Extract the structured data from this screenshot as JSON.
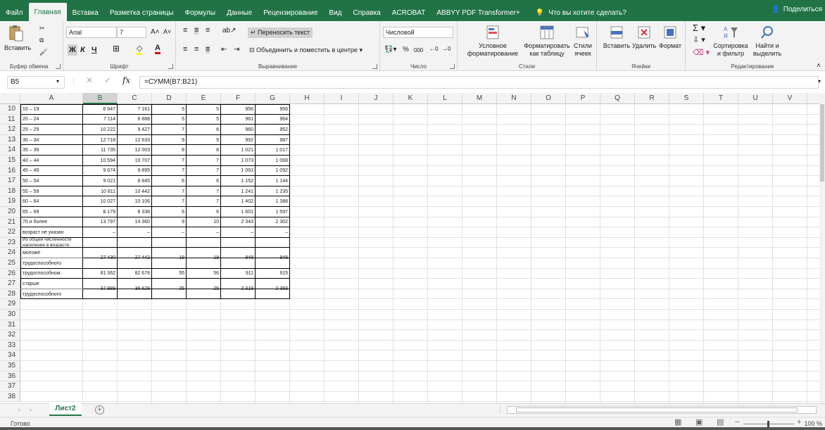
{
  "tabs": [
    "Файл",
    "Главная",
    "Вставка",
    "Разметка страницы",
    "Формулы",
    "Данные",
    "Рецензирование",
    "Вид",
    "Справка",
    "ACROBAT",
    "ABBYY PDF Transformer+"
  ],
  "active_tab": "Главная",
  "tell_me": "Что вы хотите сделать?",
  "share": "Поделиться",
  "ribbon": {
    "clipboard": {
      "paste": "Вставить",
      "label": "Буфер обмена"
    },
    "font": {
      "name": "Arial",
      "size": "7",
      "bold": "Ж",
      "italic": "К",
      "underline": "Ч",
      "label": "Шрифт"
    },
    "alignment": {
      "wrap": "Переносить текст",
      "merge": "Объединить и поместить в центре",
      "label": "Выравнивание"
    },
    "number": {
      "format": "Числовой",
      "percent": "%",
      "thousands": "000",
      "label": "Число"
    },
    "styles": {
      "conditional": "Условное форматирование",
      "as_table": "Форматировать как таблицу",
      "cell_styles": "Стили ячеек",
      "label": "Стили"
    },
    "cells": {
      "insert": "Вставить",
      "delete": "Удалить",
      "format": "Формат",
      "label": "Ячейки"
    },
    "editing": {
      "sort": "Сортировка и фильтр",
      "find": "Найти и выделить",
      "label": "Редактирование"
    }
  },
  "formula_bar": {
    "name_box": "B5",
    "formula": "=СУММ(B7:B21)"
  },
  "columns": [
    "A",
    "B",
    "C",
    "D",
    "E",
    "F",
    "G",
    "H",
    "I",
    "J",
    "K",
    "L",
    "M",
    "N",
    "O",
    "P",
    "Q",
    "R",
    "S",
    "T",
    "U",
    "V"
  ],
  "selected_column": "B",
  "rows": [
    {
      "n": "10",
      "a": "15 – 19",
      "b": "6 947",
      "c": "7 161",
      "d": "5",
      "e": "5",
      "f": "956",
      "g": "956"
    },
    {
      "n": "11",
      "a": "20 – 24",
      "b": "7 114",
      "c": "6 888",
      "d": "5",
      "e": "5",
      "f": "961",
      "g": "964"
    },
    {
      "n": "12",
      "a": "25 – 29",
      "b": "10 222",
      "c": "9 427",
      "d": "7",
      "e": "6",
      "f": "960",
      "g": "952"
    },
    {
      "n": "13",
      "a": "30 – 34",
      "b": "12 718",
      "c": "12 633",
      "d": "9",
      "e": "9",
      "f": "992",
      "g": "987"
    },
    {
      "n": "14",
      "a": "35 – 39",
      "b": "11 735",
      "c": "12 003",
      "d": "8",
      "e": "8",
      "f": "1 021",
      "g": "1 017"
    },
    {
      "n": "15",
      "a": "40 – 44",
      "b": "10 594",
      "c": "10 707",
      "d": "7",
      "e": "7",
      "f": "1 073",
      "g": "1 068"
    },
    {
      "n": "16",
      "a": "45 – 49",
      "b": "9 674",
      "c": "9 895",
      "d": "7",
      "e": "7",
      "f": "1 091",
      "g": "1 092"
    },
    {
      "n": "17",
      "a": "50 – 54",
      "b": "9 021",
      "c": "8 845",
      "d": "6",
      "e": "6",
      "f": "1 152",
      "g": "1 144"
    },
    {
      "n": "18",
      "a": "55 – 59",
      "b": "10 811",
      "c": "10 442",
      "d": "7",
      "e": "7",
      "f": "1 241",
      "g": "1 235"
    },
    {
      "n": "19",
      "a": "60 – 64",
      "b": "10 027",
      "c": "10 106",
      "d": "7",
      "e": "7",
      "f": "1 402",
      "g": "1 388"
    },
    {
      "n": "20",
      "a": "65 – 69",
      "b": "8 179",
      "c": "8 338",
      "d": "6",
      "e": "6",
      "f": "1 601",
      "g": "1 597"
    },
    {
      "n": "21",
      "a": "70 и более",
      "b": "13 797",
      "c": "14 360",
      "d": "9",
      "e": "10",
      "f": "2 343",
      "g": "2 302"
    },
    {
      "n": "22",
      "a": "возраст не указан",
      "b": "–",
      "c": "–",
      "d": "–",
      "e": "–",
      "f": "–",
      "g": "–"
    },
    {
      "n": "23",
      "a": "Из общей численности население в возрасте:",
      "b": "",
      "c": "",
      "d": "",
      "e": "",
      "f": "",
      "g": ""
    },
    {
      "n": "24",
      "a": "моложе",
      "b": "27 430",
      "c": "27 442",
      "d": "19",
      "e": "19",
      "f": "949",
      "g": "948"
    },
    {
      "n": "25",
      "a": "трудоспособного",
      "b": "",
      "c": "",
      "d": "",
      "e": "",
      "f": "",
      "g": ""
    },
    {
      "n": "26",
      "a": "трудоспособном.",
      "b": "81 362",
      "c": "82 678",
      "d": "55",
      "e": "56",
      "f": "911",
      "g": "915"
    },
    {
      "n": "27",
      "a": "старше",
      "b": "37 989",
      "c": "36 628",
      "d": "26",
      "e": "25",
      "f": "2 319",
      "g": "2 368"
    },
    {
      "n": "28",
      "a": "трудоспособного",
      "b": "",
      "c": "",
      "d": "",
      "e": "",
      "f": "",
      "g": ""
    },
    {
      "n": "29"
    },
    {
      "n": "30"
    },
    {
      "n": "31"
    },
    {
      "n": "32"
    },
    {
      "n": "33"
    },
    {
      "n": "34"
    },
    {
      "n": "35"
    },
    {
      "n": "36"
    },
    {
      "n": "37"
    },
    {
      "n": "38"
    }
  ],
  "sheet_tab": "Лист2",
  "status": "Готово",
  "zoom": "100 %"
}
